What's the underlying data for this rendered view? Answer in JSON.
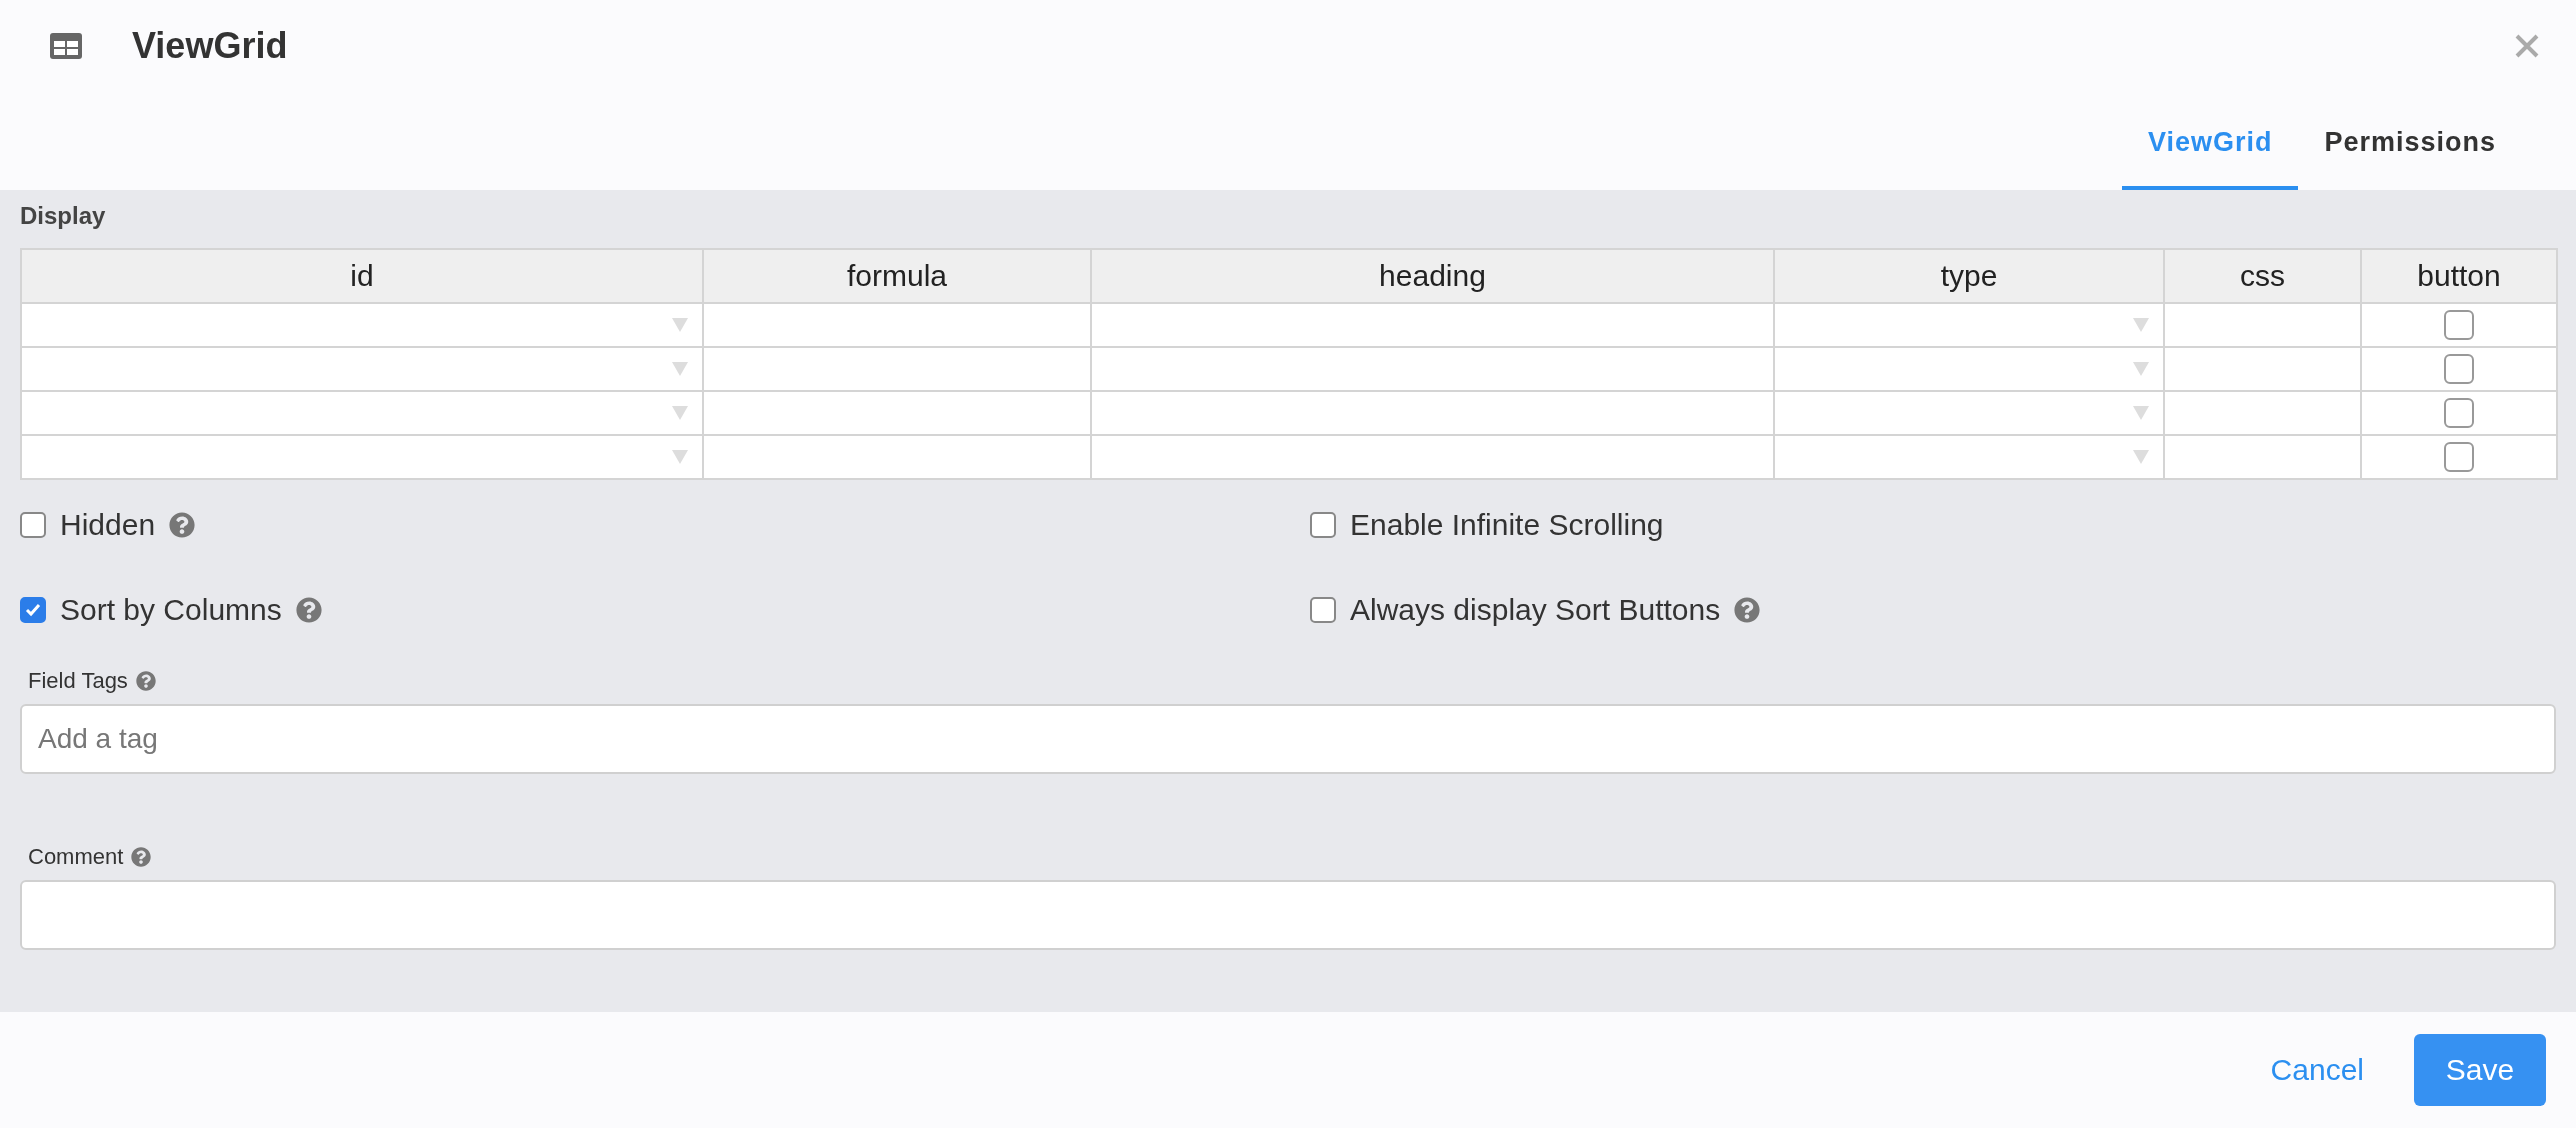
{
  "window": {
    "title": "ViewGrid"
  },
  "tabs": [
    {
      "label": "ViewGrid",
      "selected": true
    },
    {
      "label": "Permissions",
      "selected": false
    }
  ],
  "section": {
    "title": "Display"
  },
  "table": {
    "columns": [
      {
        "label": "id",
        "kind": "select"
      },
      {
        "label": "formula",
        "kind": "text"
      },
      {
        "label": "heading",
        "kind": "text"
      },
      {
        "label": "type",
        "kind": "select"
      },
      {
        "label": "css",
        "kind": "text"
      },
      {
        "label": "button",
        "kind": "checkbox"
      }
    ],
    "rows": [
      {
        "checked": false
      },
      {
        "checked": false
      },
      {
        "checked": false
      },
      {
        "checked": false
      }
    ]
  },
  "options": [
    {
      "label": "Hidden",
      "checked": false,
      "help": true
    },
    {
      "label": "Enable Infinite Scrolling",
      "checked": false,
      "help": false
    },
    {
      "label": "Sort by Columns",
      "checked": true,
      "help": true
    },
    {
      "label": "Always display Sort Buttons",
      "checked": false,
      "help": true
    }
  ],
  "fields": [
    {
      "label": "Field Tags",
      "placeholder": "Add a tag"
    },
    {
      "label": "Comment"
    }
  ],
  "buttons": [
    {
      "label": "Cancel",
      "kind": "link"
    },
    {
      "label": "Save",
      "kind": "primary"
    }
  ]
}
